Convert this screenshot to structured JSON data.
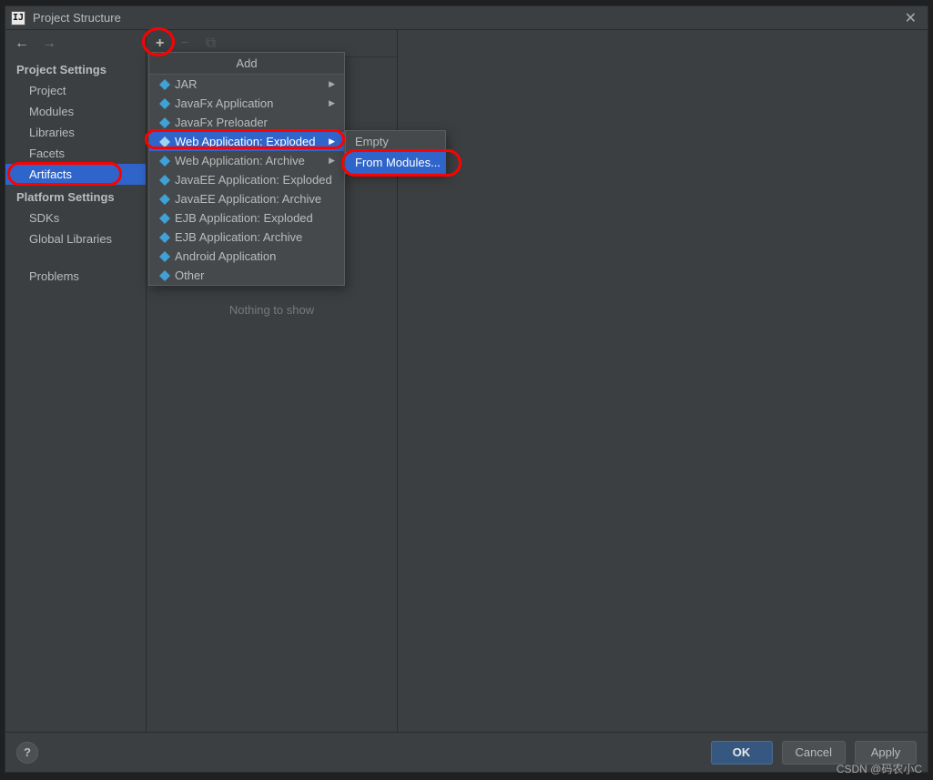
{
  "window": {
    "title": "Project Structure",
    "close_glyph": "✕"
  },
  "sidebar": {
    "nav_back": "←",
    "nav_fwd": "→",
    "heading1": "Project Settings",
    "items1": [
      {
        "label": "Project"
      },
      {
        "label": "Modules"
      },
      {
        "label": "Libraries"
      },
      {
        "label": "Facets"
      },
      {
        "label": "Artifacts",
        "selected": true
      }
    ],
    "heading2": "Platform Settings",
    "items2": [
      {
        "label": "SDKs"
      },
      {
        "label": "Global Libraries"
      }
    ],
    "items3": [
      {
        "label": "Problems"
      }
    ]
  },
  "toolbar": {
    "plus": "+",
    "minus": "−",
    "copy": "⧉"
  },
  "list_panel": {
    "empty_text": "Nothing to show"
  },
  "popup1": {
    "title": "Add",
    "items": [
      {
        "label": "JAR",
        "submenu": true
      },
      {
        "label": "JavaFx Application",
        "submenu": true
      },
      {
        "label": "JavaFx Preloader"
      },
      {
        "label": "Web Application: Exploded",
        "submenu": true,
        "selected": true
      },
      {
        "label": "Web Application: Archive",
        "submenu": true
      },
      {
        "label": "JavaEE Application: Exploded"
      },
      {
        "label": "JavaEE Application: Archive"
      },
      {
        "label": "EJB Application: Exploded"
      },
      {
        "label": "EJB Application: Archive"
      },
      {
        "label": "Android Application"
      },
      {
        "label": "Other"
      }
    ]
  },
  "popup2": {
    "items": [
      {
        "label": "Empty"
      },
      {
        "label": "From Modules...",
        "selected": true
      }
    ]
  },
  "footer": {
    "help": "?",
    "ok": "OK",
    "cancel": "Cancel",
    "apply": "Apply"
  },
  "watermark": "CSDN @码农小C"
}
